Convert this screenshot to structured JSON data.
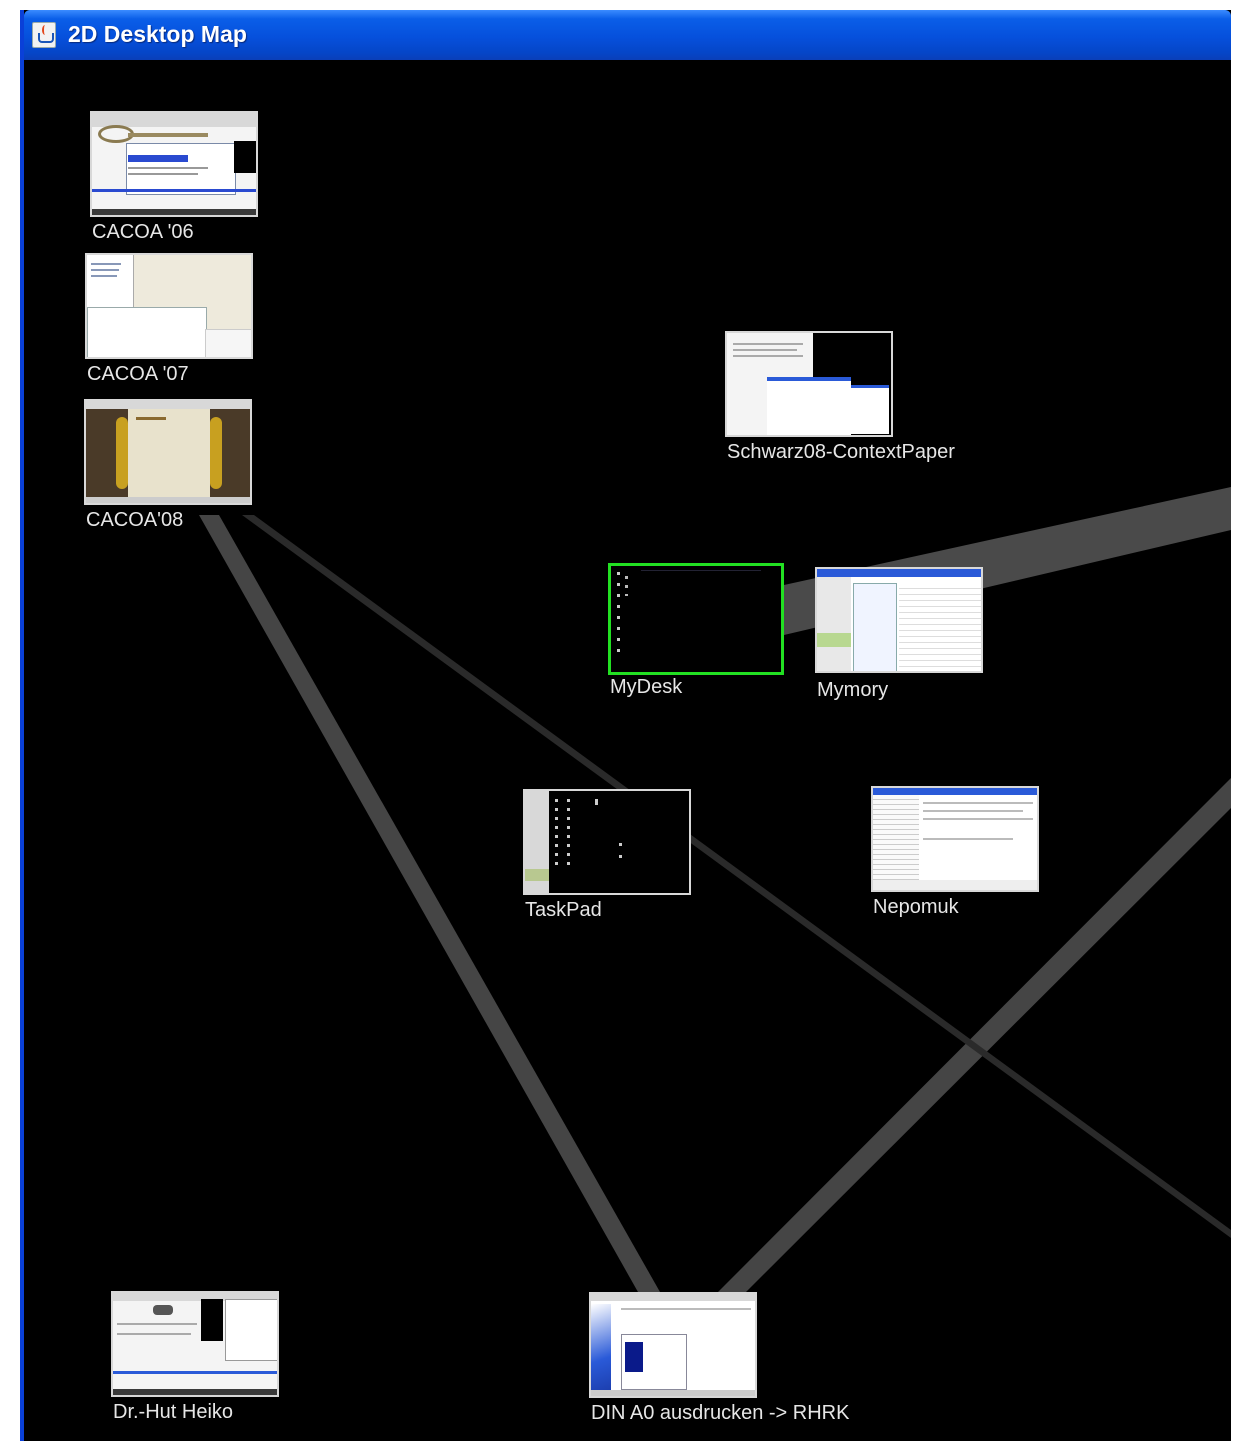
{
  "window": {
    "title": "2D Desktop Map",
    "icon": "java-cup-icon",
    "colors": {
      "titlebar": "#0650dc",
      "canvas": "#000000",
      "edge": "#4a4a4a",
      "selection": "#22e022",
      "label": "#e6e6e6"
    }
  },
  "nodes": [
    {
      "id": "cacoa06",
      "label": "CACOA '06",
      "selected": false
    },
    {
      "id": "cacoa07",
      "label": "CACOA '07",
      "selected": false
    },
    {
      "id": "cacoa08",
      "label": "CACOA'08",
      "selected": false
    },
    {
      "id": "schwarz08",
      "label": "Schwarz08-ContextPaper",
      "selected": false
    },
    {
      "id": "mydesk",
      "label": "MyDesk",
      "selected": true
    },
    {
      "id": "mymory",
      "label": "Mymory",
      "selected": false
    },
    {
      "id": "taskpad",
      "label": "TaskPad",
      "selected": false
    },
    {
      "id": "nepomuk",
      "label": "Nepomuk",
      "selected": false
    },
    {
      "id": "drhut",
      "label": "Dr.-Hut Heiko",
      "selected": false
    },
    {
      "id": "dina0",
      "label": "DIN A0 ausdrucken -> RHRK",
      "selected": false
    }
  ]
}
